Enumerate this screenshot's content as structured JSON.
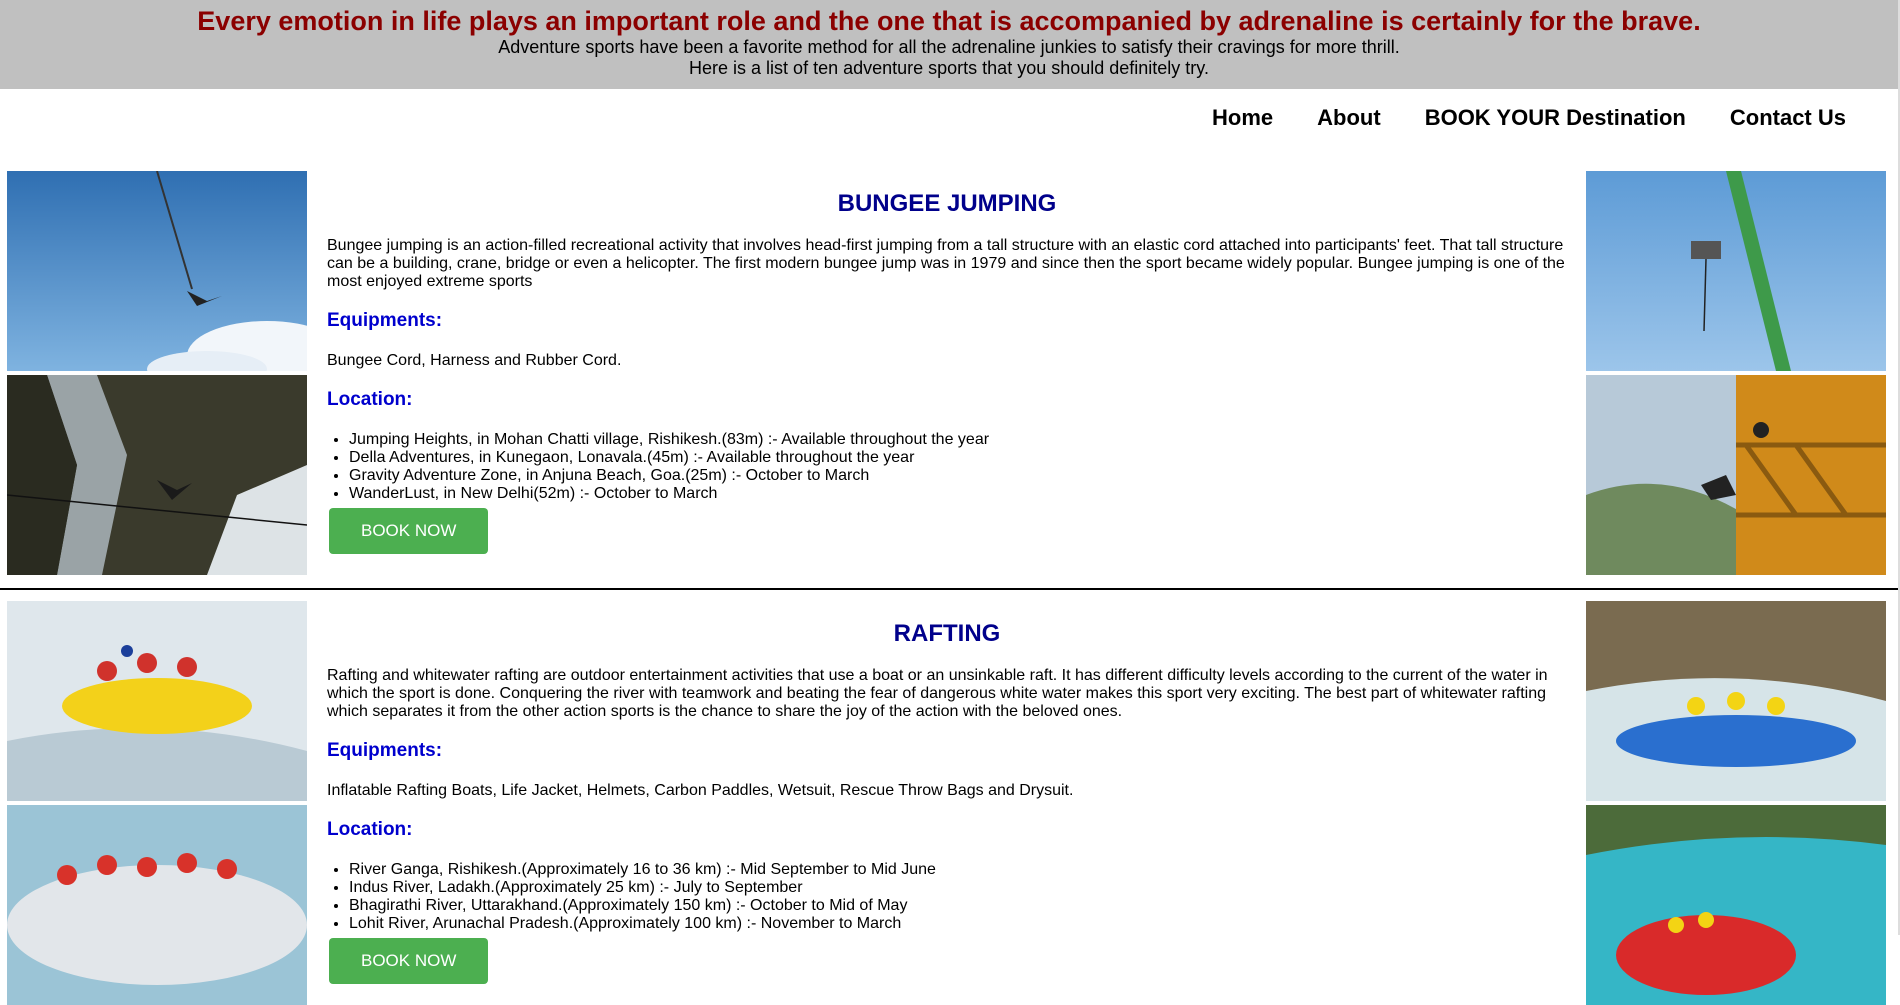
{
  "header": {
    "headline": "Every emotion in life plays an important role and the one that is accompanied by adrenaline is certainly for the brave.",
    "subline1": "Adventure sports have been a favorite method for all the adrenaline junkies to satisfy their cravings for more thrill.",
    "subline2": "Here is a list of ten adventure sports that you should definitely try."
  },
  "nav": {
    "items": [
      {
        "label": "Home"
      },
      {
        "label": "About"
      },
      {
        "label": "BOOK YOUR Destination"
      },
      {
        "label": "Contact Us"
      }
    ]
  },
  "sections": [
    {
      "title": "BUNGEE JUMPING",
      "description": "Bungee jumping is an action-filled recreational activity that involves head-first jumping from a tall structure with an elastic cord attached into participants' feet. That tall structure can be a building, crane, bridge or even a helicopter. The first modern bungee jump was in 1979 and since then the sport became widely popular. Bungee jumping is one of the most enjoyed extreme sports",
      "equipments_heading": "Equipments:",
      "equipments": "Bungee Cord, Harness and Rubber Cord.",
      "location_heading": "Location:",
      "locations": [
        "Jumping Heights, in Mohan Chatti village, Rishikesh.(83m) :-  Available throughout the year",
        "Della Adventures, in Kunegaon, Lonavala.(45m) :- Available throughout the year",
        "Gravity Adventure Zone, in Anjuna Beach, Goa.(25m) :- October to March",
        "WanderLust, in New Delhi(52m) :- October to March"
      ],
      "button": "BOOK NOW"
    },
    {
      "title": "RAFTING",
      "description": "Rafting and whitewater rafting are outdoor entertainment activities that use a boat or an unsinkable raft. It has different difficulty levels according to the current of the water in which the sport is done. Conquering the river with teamwork and beating the fear of dangerous white water makes this sport very exciting. The best part of whitewater rafting which separates it from the other action sports is the chance to share the joy of the action with the beloved ones.",
      "equipments_heading": "Equipments:",
      "equipments": "Inflatable Rafting Boats, Life Jacket, Helmets, Carbon Paddles, Wetsuit, Rescue Throw Bags and Drysuit.",
      "location_heading": "Location:",
      "locations": [
        "River Ganga, Rishikesh.(Approximately 16 to 36 km) :-  Mid September to Mid June",
        "Indus River, Ladakh.(Approximately 25 km) :-  July to September",
        "Bhagirathi River, Uttarakhand.(Approximately 150 km) :-  October to Mid of May",
        "Lohit River, Arunachal Pradesh.(Approximately 100 km) :-  November to March"
      ],
      "button": "BOOK NOW"
    }
  ],
  "colors": {
    "header_bg": "#c0c0c0",
    "headline": "#8b0000",
    "section_title": "#00008b",
    "subheading": "#0000cd",
    "button": "#4caf50"
  }
}
